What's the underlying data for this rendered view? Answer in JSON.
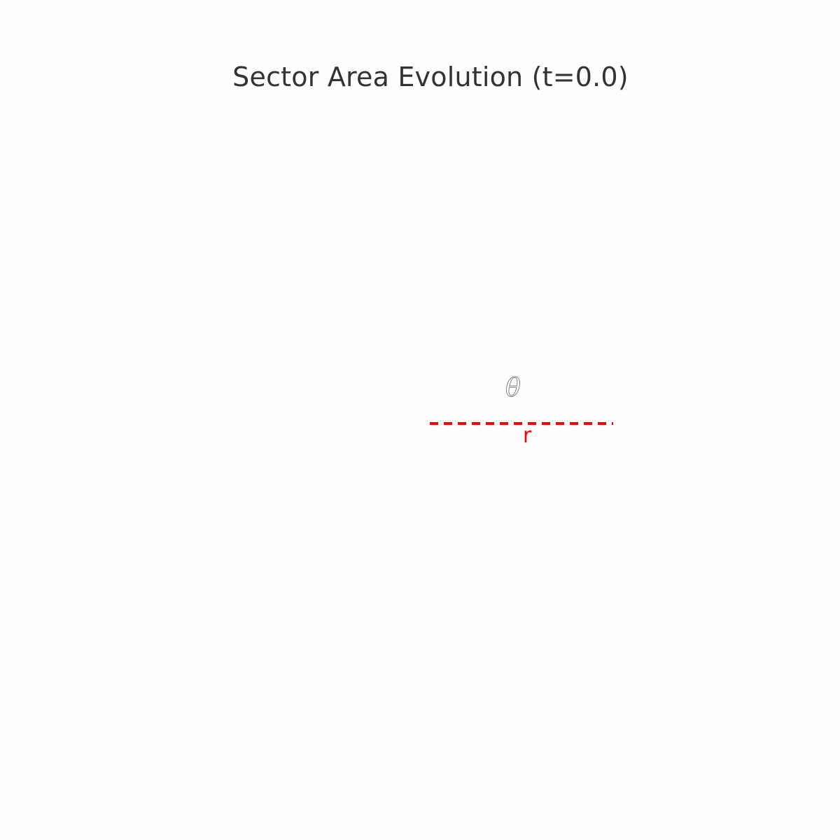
{
  "title": "Sector Area Evolution (t=0.0)",
  "diagram": {
    "angle_label": "θ",
    "radius_label": "r",
    "theta_value": 0.0,
    "colors": {
      "background": "#fdfdfd",
      "title": "#333333",
      "radius_line": "#ff0000",
      "angle_label": "#555555"
    }
  }
}
